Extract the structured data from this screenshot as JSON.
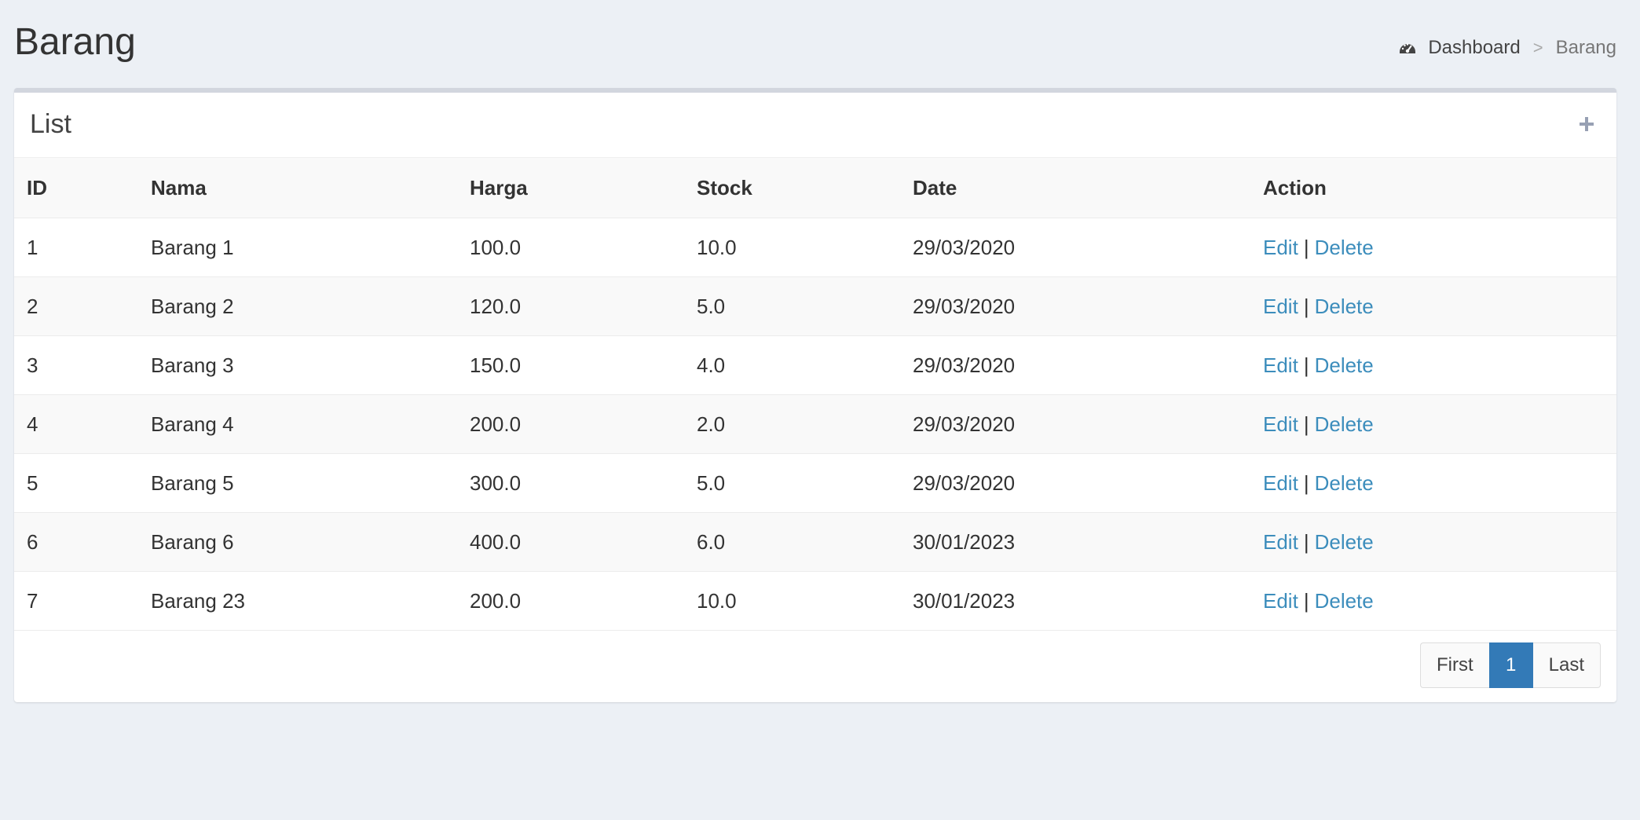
{
  "page": {
    "title": "Barang"
  },
  "breadcrumb": {
    "icon": "tachometer-icon",
    "items": [
      "Dashboard",
      "Barang"
    ],
    "separator": ">"
  },
  "box": {
    "title": "List",
    "add_icon": "plus-icon"
  },
  "table": {
    "headers": [
      "ID",
      "Nama",
      "Harga",
      "Stock",
      "Date",
      "Action"
    ],
    "rows": [
      {
        "id": "1",
        "nama": "Barang 1",
        "harga": "100.0",
        "stock": "10.0",
        "date": "29/03/2020"
      },
      {
        "id": "2",
        "nama": "Barang 2",
        "harga": "120.0",
        "stock": "5.0",
        "date": "29/03/2020"
      },
      {
        "id": "3",
        "nama": "Barang 3",
        "harga": "150.0",
        "stock": "4.0",
        "date": "29/03/2020"
      },
      {
        "id": "4",
        "nama": "Barang 4",
        "harga": "200.0",
        "stock": "2.0",
        "date": "29/03/2020"
      },
      {
        "id": "5",
        "nama": "Barang 5",
        "harga": "300.0",
        "stock": "5.0",
        "date": "29/03/2020"
      },
      {
        "id": "6",
        "nama": "Barang 6",
        "harga": "400.0",
        "stock": "6.0",
        "date": "30/01/2023"
      },
      {
        "id": "7",
        "nama": "Barang 23",
        "harga": "200.0",
        "stock": "10.0",
        "date": "30/01/2023"
      }
    ],
    "edit_label": "Edit",
    "delete_label": "Delete",
    "action_separator": "|"
  },
  "pagination": {
    "first_label": "First",
    "current_page": "1",
    "last_label": "Last"
  },
  "colors": {
    "background": "#ecf0f5",
    "link": "#3c8dbc",
    "active_page": "#337ab7",
    "box_border": "#d2d6de"
  }
}
